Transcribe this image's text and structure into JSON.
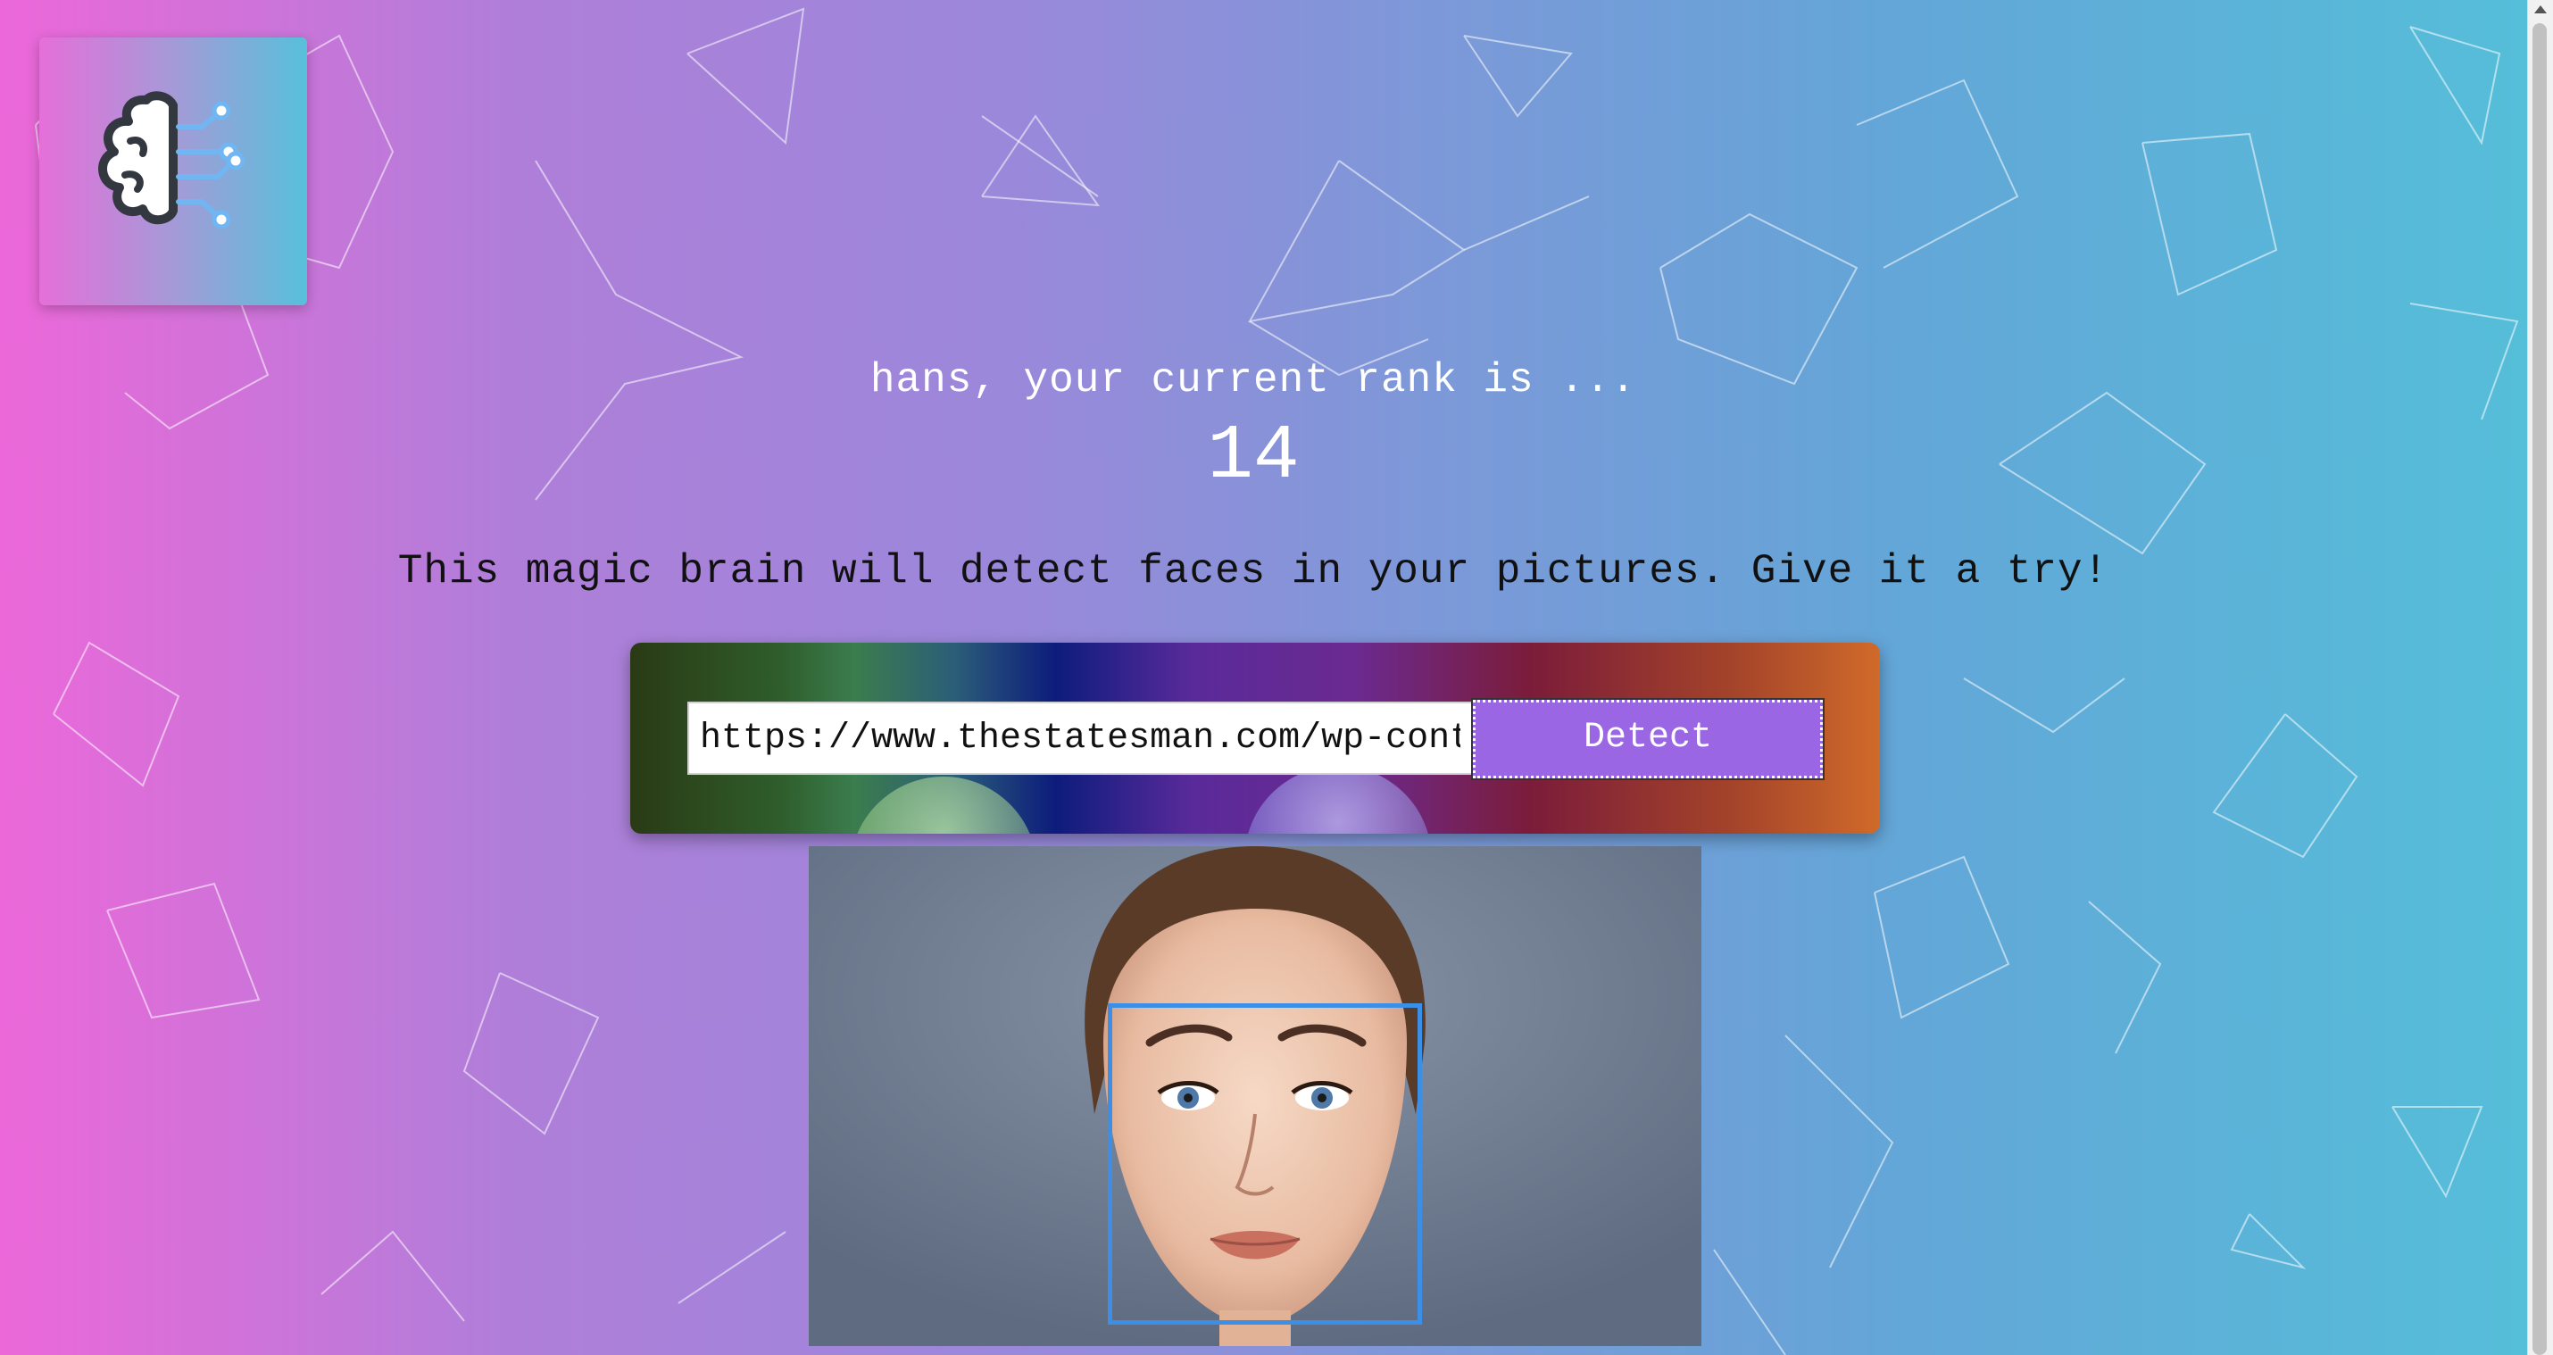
{
  "app": {
    "logo_icon": "brain-circuit-icon"
  },
  "rank": {
    "message": "hans, your current rank is ...",
    "number": "14"
  },
  "tagline": "This magic brain will detect faces in your pictures. Give it a try!",
  "form": {
    "url_value": "https://www.thestatesman.com/wp-cont",
    "detect_label": "Detect"
  },
  "result": {
    "image_description_icon": "portrait-photo",
    "face_count": 1
  },
  "colors": {
    "gradient_left": "#ec68d9",
    "gradient_right": "#55bed9",
    "button": "#9a66e4",
    "face_box": "#3b8fe6"
  }
}
